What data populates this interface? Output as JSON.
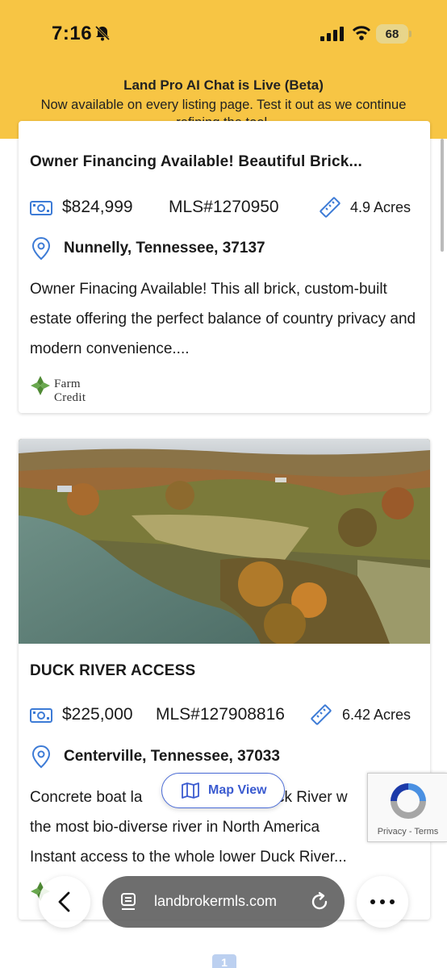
{
  "status_bar": {
    "time": "7:16",
    "battery": "68",
    "battery_level": 0.68
  },
  "banner": {
    "title": "Land Pro AI Chat is Live (Beta)",
    "text": "Now available on every listing page. Test it out as we continue refining the tool."
  },
  "listings": [
    {
      "title": "Owner Financing Available! Beautiful Brick...",
      "price": "$824,999",
      "mls": "MLS#1270950",
      "acres": "4.9 Acres",
      "location": "Nunnelly, Tennessee, 37137",
      "description": "Owner Finacing Available! This all brick, custom-built estate offering the perfect balance of country privacy and modern convenience....",
      "logo": "Farm Credit"
    },
    {
      "title": "DUCK RIVER ACCESS",
      "price": "$225,000",
      "mls": "MLS#127908816",
      "acres": "6.42 Acres",
      "location": "Centerville, Tennessee, 37033",
      "description": "Concrete boat launch on the Duck River w... the most bio-diverse river in North America. Instant access to the whole lower Duck River...",
      "desc_lines": [
        "Concrete boat la",
        "ck River w",
        "the most bio-diverse river in North America",
        "Instant access to the whole lower Duck River..."
      ],
      "logo": "Farm Credit"
    }
  ],
  "map_view": {
    "label": "Map View"
  },
  "recaptcha": {
    "links": "Privacy - Terms"
  },
  "browser": {
    "url": "landbrokermls.com"
  },
  "pagination": {
    "current": "1"
  },
  "colors": {
    "banner": "#f7c544",
    "accent_blue": "#3b5bd0",
    "icon_blue": "#3d7bd6"
  }
}
